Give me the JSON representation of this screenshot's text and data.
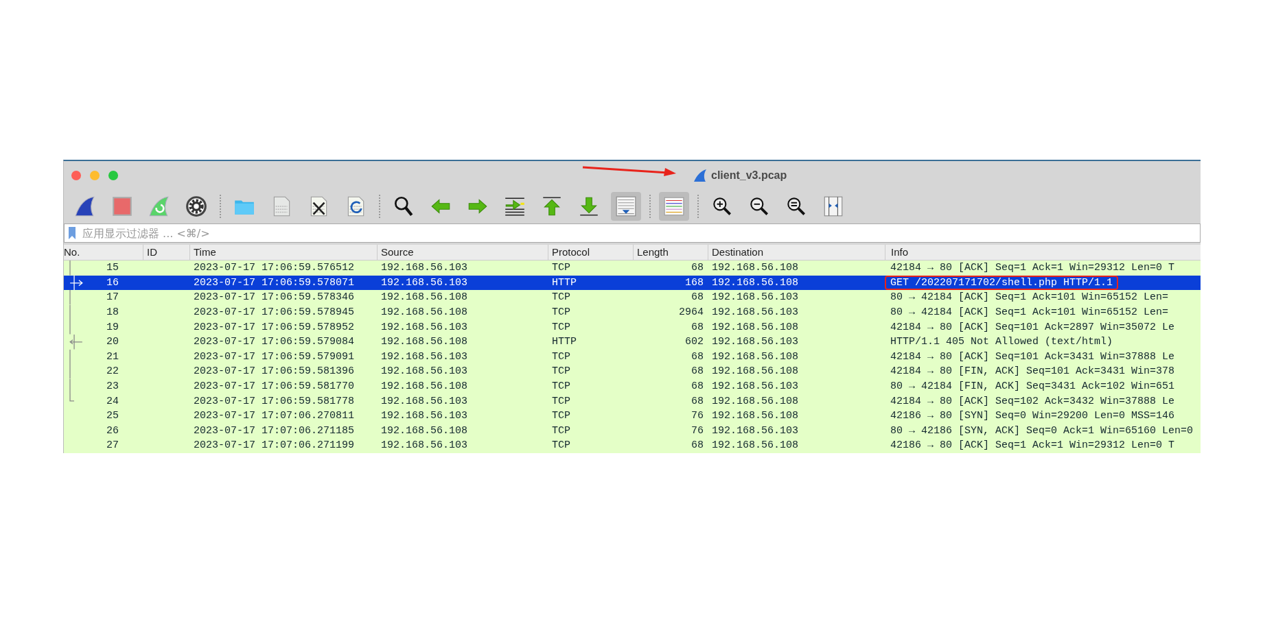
{
  "window": {
    "title": "client_v3.pcap"
  },
  "annotations": {
    "arrow_to_title": true
  },
  "toolbar": [
    [
      {
        "kind": "start",
        "pressed": false
      },
      {
        "kind": "stop",
        "pressed": false
      },
      {
        "kind": "restart",
        "pressed": false
      },
      {
        "kind": "options",
        "pressed": false
      }
    ],
    [
      {
        "kind": "open",
        "pressed": false
      },
      {
        "kind": "file",
        "pressed": false
      },
      {
        "kind": "close",
        "pressed": false
      },
      {
        "kind": "reload",
        "pressed": false
      }
    ],
    [
      {
        "kind": "find",
        "pressed": false
      },
      {
        "kind": "back",
        "pressed": false
      },
      {
        "kind": "forward",
        "pressed": false
      },
      {
        "kind": "goto",
        "pressed": false
      },
      {
        "kind": "first",
        "pressed": false
      },
      {
        "kind": "last",
        "pressed": false
      },
      {
        "kind": "autoscroll",
        "pressed": true
      }
    ],
    [
      {
        "kind": "colorize",
        "pressed": true
      }
    ],
    [
      {
        "kind": "zoom-in",
        "pressed": false
      },
      {
        "kind": "zoom-out",
        "pressed": false
      },
      {
        "kind": "zoom-reset",
        "pressed": false
      },
      {
        "kind": "resize",
        "pressed": false
      }
    ]
  ],
  "filter": {
    "placeholder": "应用显示过滤器 ... <⌘/>"
  },
  "table": {
    "columns": [
      "No.",
      "ID",
      "Time",
      "Source",
      "Protocol",
      "Length",
      "Destination",
      "Info"
    ],
    "rows": [
      {
        "no": "15",
        "time": "2023-07-17 17:06:59.576512",
        "source": "192.168.56.103",
        "protocol": "TCP",
        "length": "68",
        "destination": "192.168.56.108",
        "info": "42184 → 80 [ACK] Seq=1 Ack=1 Win=29312 Len=0 T",
        "selected": false,
        "highlighted": false,
        "kind": "through"
      },
      {
        "no": "16",
        "time": "2023-07-17 17:06:59.578071",
        "source": "192.168.56.103",
        "protocol": "HTTP",
        "length": "168",
        "destination": "192.168.56.108",
        "info": "GET /202207171702/shell.php HTTP/1.1",
        "selected": true,
        "highlighted": true,
        "kind": "request"
      },
      {
        "no": "17",
        "time": "2023-07-17 17:06:59.578346",
        "source": "192.168.56.108",
        "protocol": "TCP",
        "length": "68",
        "destination": "192.168.56.103",
        "info": "80 → 42184 [ACK] Seq=1 Ack=101 Win=65152 Len=",
        "selected": false,
        "highlighted": false,
        "kind": "through"
      },
      {
        "no": "18",
        "time": "2023-07-17 17:06:59.578945",
        "source": "192.168.56.108",
        "protocol": "TCP",
        "length": "2964",
        "destination": "192.168.56.103",
        "info": "80 → 42184 [ACK] Seq=1 Ack=101 Win=65152 Len=",
        "selected": false,
        "highlighted": false,
        "kind": "through"
      },
      {
        "no": "19",
        "time": "2023-07-17 17:06:59.578952",
        "source": "192.168.56.103",
        "protocol": "TCP",
        "length": "68",
        "destination": "192.168.56.108",
        "info": "42184 → 80 [ACK] Seq=101 Ack=2897 Win=35072 Le",
        "selected": false,
        "highlighted": false,
        "kind": "through"
      },
      {
        "no": "20",
        "time": "2023-07-17 17:06:59.579084",
        "source": "192.168.56.108",
        "protocol": "HTTP",
        "length": "602",
        "destination": "192.168.56.103",
        "info": "HTTP/1.1 405 Not Allowed  (text/html)",
        "selected": false,
        "highlighted": false,
        "kind": "response"
      },
      {
        "no": "21",
        "time": "2023-07-17 17:06:59.579091",
        "source": "192.168.56.103",
        "protocol": "TCP",
        "length": "68",
        "destination": "192.168.56.108",
        "info": "42184 → 80 [ACK] Seq=101 Ack=3431 Win=37888 Le",
        "selected": false,
        "highlighted": false,
        "kind": "through"
      },
      {
        "no": "22",
        "time": "2023-07-17 17:06:59.581396",
        "source": "192.168.56.103",
        "protocol": "TCP",
        "length": "68",
        "destination": "192.168.56.108",
        "info": "42184 → 80 [FIN, ACK] Seq=101 Ack=3431 Win=378",
        "selected": false,
        "highlighted": false,
        "kind": "through"
      },
      {
        "no": "23",
        "time": "2023-07-17 17:06:59.581770",
        "source": "192.168.56.108",
        "protocol": "TCP",
        "length": "68",
        "destination": "192.168.56.103",
        "info": "80 → 42184 [FIN, ACK] Seq=3431 Ack=102 Win=651",
        "selected": false,
        "highlighted": false,
        "kind": "through"
      },
      {
        "no": "24",
        "time": "2023-07-17 17:06:59.581778",
        "source": "192.168.56.103",
        "protocol": "TCP",
        "length": "68",
        "destination": "192.168.56.108",
        "info": "42184 → 80 [ACK] Seq=102 Ack=3432 Win=37888 Le",
        "selected": false,
        "highlighted": false,
        "kind": "end"
      },
      {
        "no": "25",
        "time": "2023-07-17 17:07:06.270811",
        "source": "192.168.56.103",
        "protocol": "TCP",
        "length": "76",
        "destination": "192.168.56.108",
        "info": "42186 → 80 [SYN] Seq=0 Win=29200 Len=0 MSS=146",
        "selected": false,
        "highlighted": false,
        "kind": "none"
      },
      {
        "no": "26",
        "time": "2023-07-17 17:07:06.271185",
        "source": "192.168.56.108",
        "protocol": "TCP",
        "length": "76",
        "destination": "192.168.56.103",
        "info": "80 → 42186 [SYN, ACK] Seq=0 Ack=1 Win=65160 Len=0",
        "selected": false,
        "highlighted": false,
        "kind": "none"
      },
      {
        "no": "27",
        "time": "2023-07-17 17:07:06.271199",
        "source": "192.168.56.103",
        "protocol": "TCP",
        "length": "68",
        "destination": "192.168.56.108",
        "info": "42186 → 80 [ACK] Seq=1 Ack=1 Win=29312 Len=0 T",
        "selected": false,
        "highlighted": false,
        "kind": "none"
      }
    ]
  }
}
